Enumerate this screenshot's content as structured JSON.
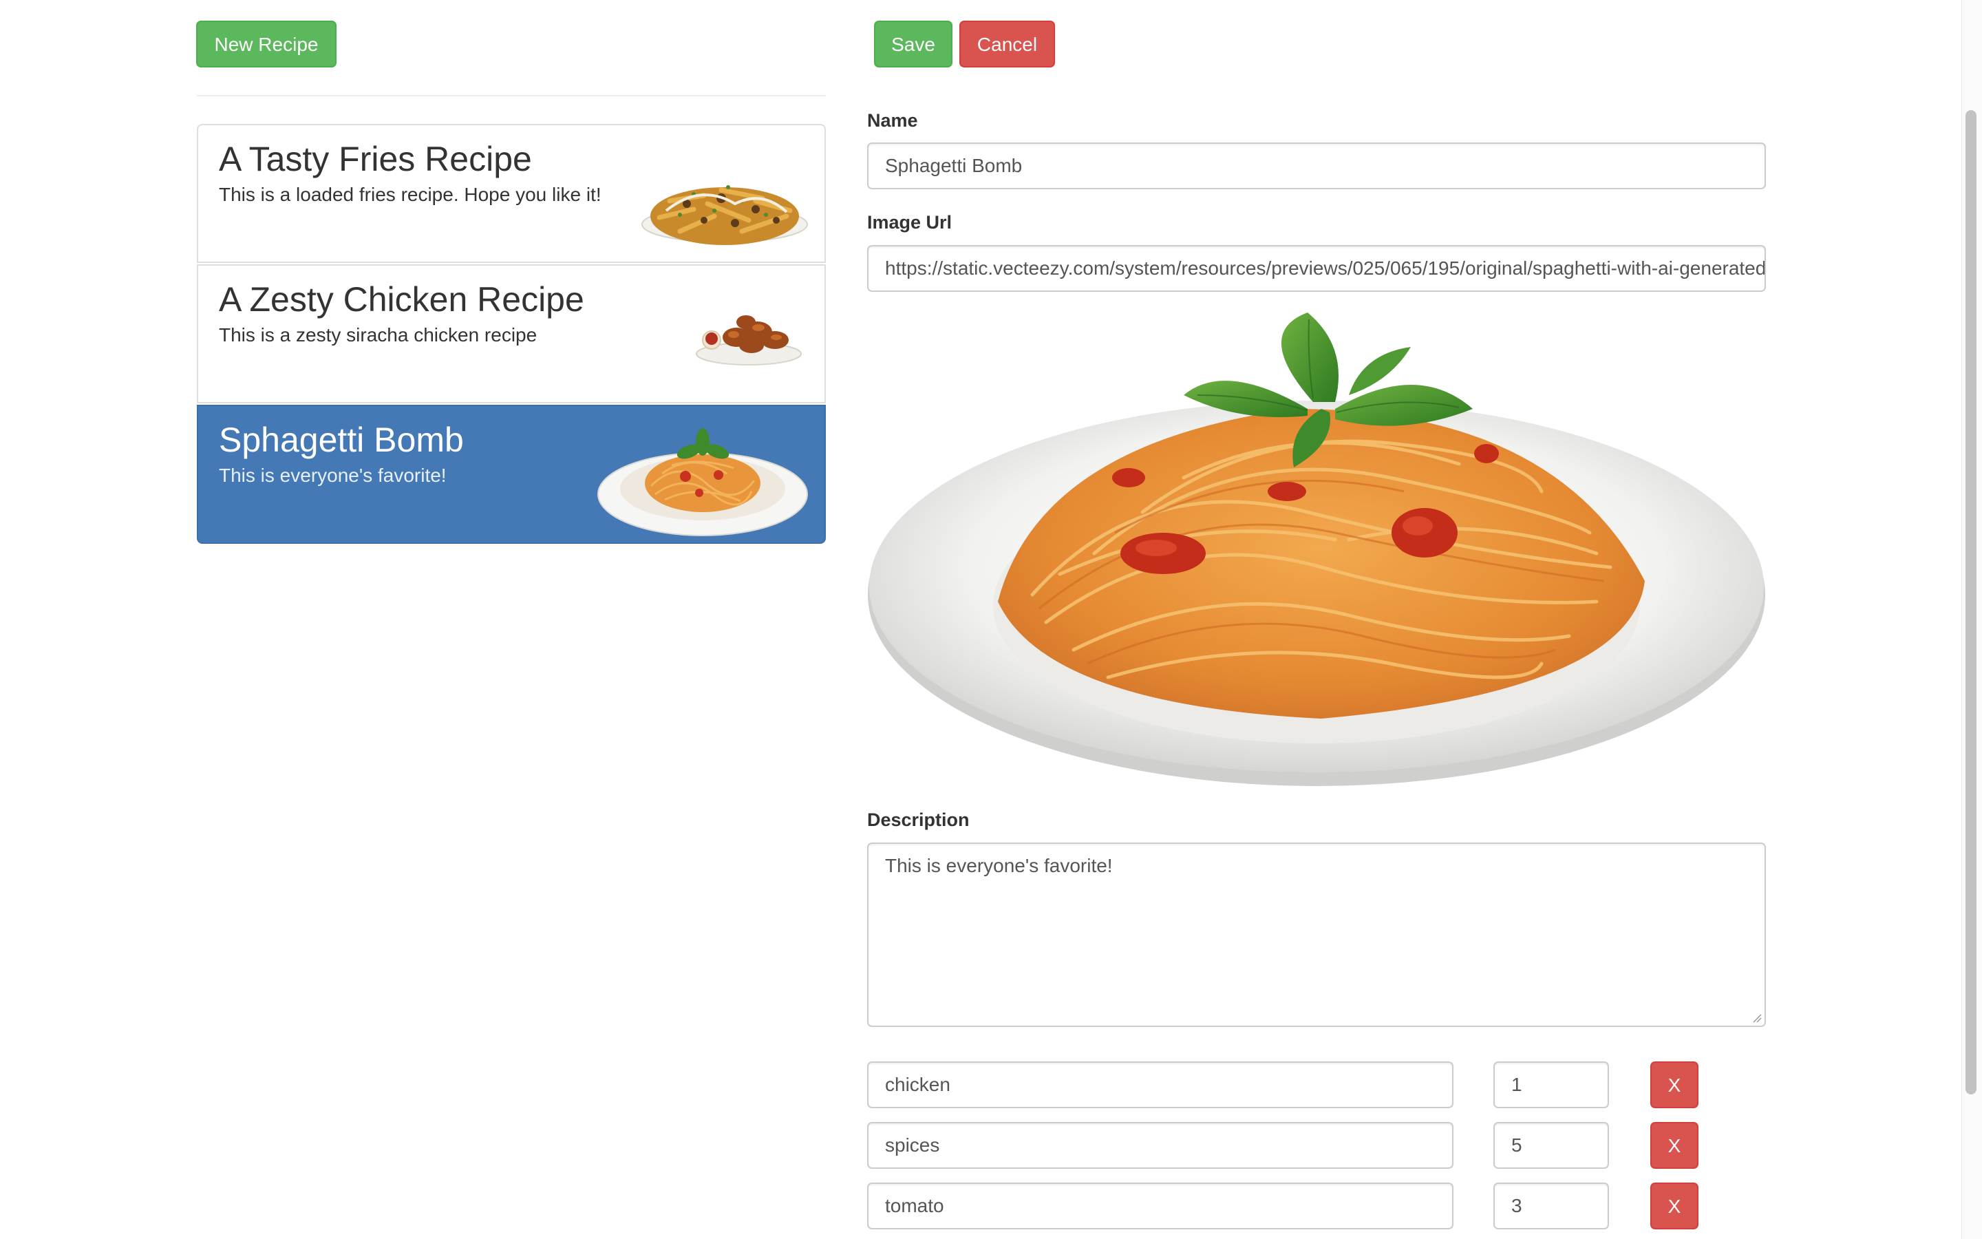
{
  "toolbar": {
    "new_recipe_label": "New Recipe",
    "save_label": "Save",
    "cancel_label": "Cancel"
  },
  "recipes": [
    {
      "title": "A Tasty Fries Recipe",
      "description": "This is a loaded fries recipe. Hope you like it!",
      "image": "loaded-fries-image",
      "active": false
    },
    {
      "title": "A Zesty Chicken Recipe",
      "description": "This is a zesty siracha chicken recipe",
      "image": "fried-chicken-image",
      "active": false
    },
    {
      "title": "Sphagetti Bomb",
      "description": "This is everyone's favorite!",
      "image": "spaghetti-image",
      "active": true
    }
  ],
  "form": {
    "name_label": "Name",
    "name_value": "Sphagetti Bomb",
    "image_url_label": "Image Url",
    "image_url_value": "https://static.vecteezy.com/system/resources/previews/025/065/195/original/spaghetti-with-ai-generated-free-png.png",
    "preview_image": "spaghetti-plate-preview",
    "description_label": "Description",
    "description_value": "This is everyone's favorite!"
  },
  "ingredients": [
    {
      "name": "chicken",
      "amount": "1",
      "remove_label": "X"
    },
    {
      "name": "spices",
      "amount": "5",
      "remove_label": "X"
    },
    {
      "name": "tomato",
      "amount": "3",
      "remove_label": "X"
    }
  ],
  "colors": {
    "success": "#5cb85c",
    "danger": "#d9534f",
    "active_item": "#4479b5"
  }
}
